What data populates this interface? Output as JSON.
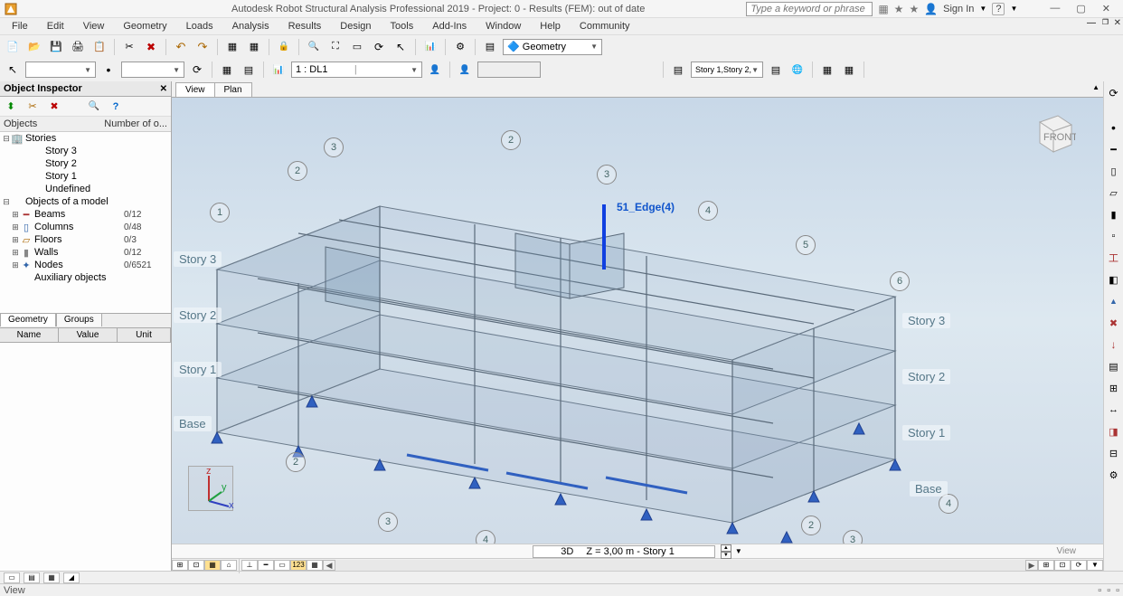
{
  "titlebar": {
    "title": "Autodesk Robot Structural Analysis Professional 2019 - Project: 0 - Results (FEM): out of date",
    "search_placeholder": "Type a keyword or phrase",
    "signin": "Sign In"
  },
  "menu": {
    "items": [
      "File",
      "Edit",
      "View",
      "Geometry",
      "Loads",
      "Analysis",
      "Results",
      "Design",
      "Tools",
      "Add-Ins",
      "Window",
      "Help",
      "Community"
    ]
  },
  "toolbar1": {
    "layout_combo": "Geometry"
  },
  "toolbar2": {
    "loadcase_combo": "1 : DL1",
    "story_combo": "Story 1,Story 2,S"
  },
  "inspector": {
    "title": "Object Inspector",
    "header_objects": "Objects",
    "header_count": "Number of o...",
    "tree": {
      "stories": "Stories",
      "story3": "Story 3",
      "story2": "Story 2",
      "story1": "Story 1",
      "undefined": "Undefined",
      "objmodel": "Objects of a model",
      "beams": "Beams",
      "beams_cnt": "0/12",
      "columns": "Columns",
      "columns_cnt": "0/48",
      "floors": "Floors",
      "floors_cnt": "0/3",
      "walls": "Walls",
      "walls_cnt": "0/12",
      "nodes": "Nodes",
      "nodes_cnt": "0/6521",
      "aux": "Auxiliary objects"
    },
    "geom_tab": "Geometry",
    "groups_tab": "Groups",
    "col_name": "Name",
    "col_value": "Value",
    "col_unit": "Unit"
  },
  "viewtabs": {
    "view": "View",
    "plan": "Plan"
  },
  "viewport": {
    "selection": "51_Edge(4)",
    "grids_left": [
      "1",
      "2",
      "3"
    ],
    "grids_top": [
      "2",
      "3"
    ],
    "grids_right": [
      "4",
      "5",
      "6"
    ],
    "grids_bottom_right": [
      "2",
      "3",
      "4"
    ],
    "grids_bottom_left2": [
      "4",
      "3",
      "2"
    ],
    "stories_left": [
      "Story 3",
      "Story 2",
      "Story 1",
      "Base"
    ],
    "stories_right": [
      "Story 3",
      "Story 2",
      "Story 1",
      "Base"
    ],
    "axis": {
      "x": "x",
      "y": "y",
      "z": "z"
    }
  },
  "viewstatus": {
    "mode": "3D",
    "coord": "Z = 3,00 m - Story 1",
    "right": "View"
  },
  "statusbar": {
    "left": "View"
  }
}
